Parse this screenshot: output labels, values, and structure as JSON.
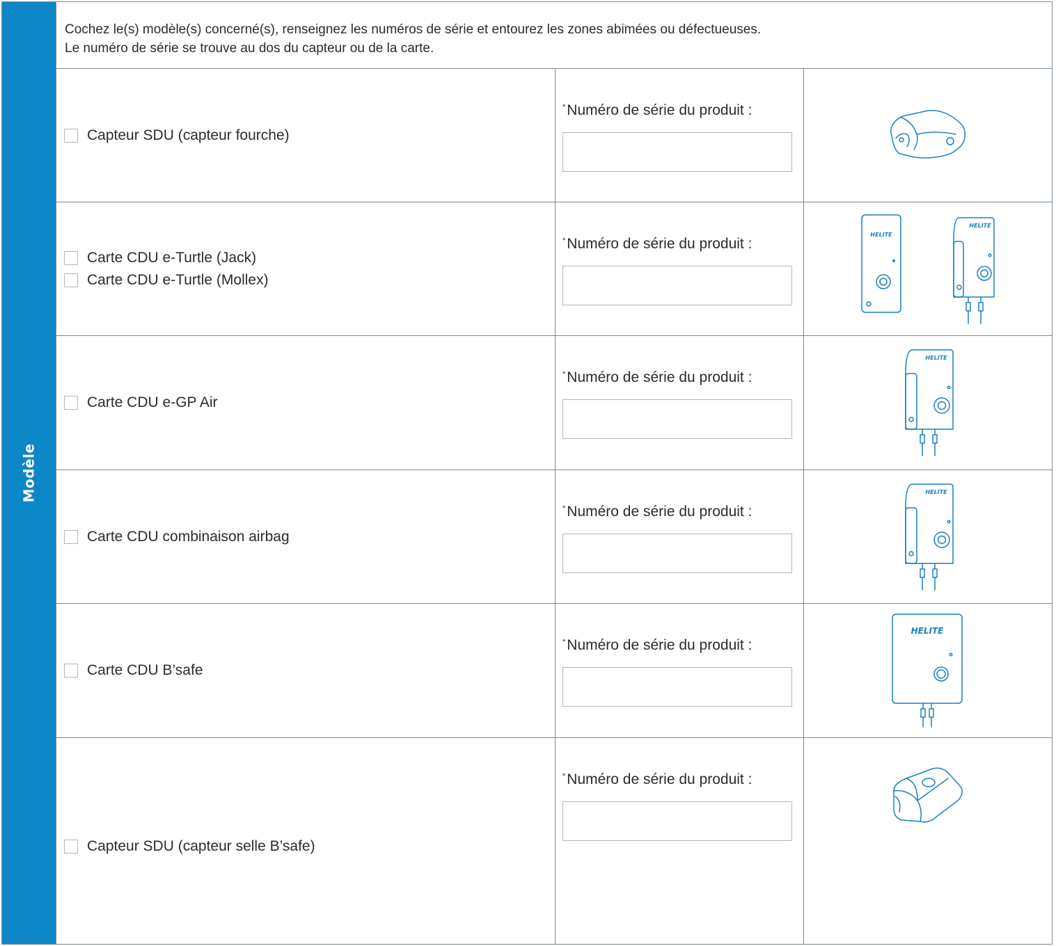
{
  "side_tab": {
    "label": "Modèle"
  },
  "instructions": {
    "line1": "Cochez le(s) modèle(s) concerné(s), renseignez les numéros de série et entourez les zones abimées ou défectueuses.",
    "line2": "Le numéro de série se trouve au dos du capteur ou de la carte."
  },
  "serial_asterisk": "*",
  "serial_label": "Numéro de série du produit :",
  "brand_logo_text": "HELITE",
  "rows": [
    {
      "options": [
        "Capteur SDU (capteur fourche)"
      ],
      "icon": "fork-sensor-icon"
    },
    {
      "options": [
        "Carte CDU e-Turtle (Jack)",
        "Carte CDU e-Turtle (Mollex)"
      ],
      "icon": "cdu-card-pair-icon"
    },
    {
      "options": [
        "Carte CDU e-GP Air"
      ],
      "icon": "cdu-card-icon"
    },
    {
      "options": [
        "Carte CDU combinaison airbag"
      ],
      "icon": "cdu-card-icon"
    },
    {
      "options": [
        "Carte CDU B’safe"
      ],
      "icon": "bsafe-card-icon"
    },
    {
      "options": [
        "Capteur SDU (capteur selle B’safe)"
      ],
      "icon": "saddle-sensor-icon"
    }
  ],
  "colors": {
    "accent": "#0d86c8",
    "border": "#7a8a96",
    "icon_stroke": "#1a7fc0"
  }
}
